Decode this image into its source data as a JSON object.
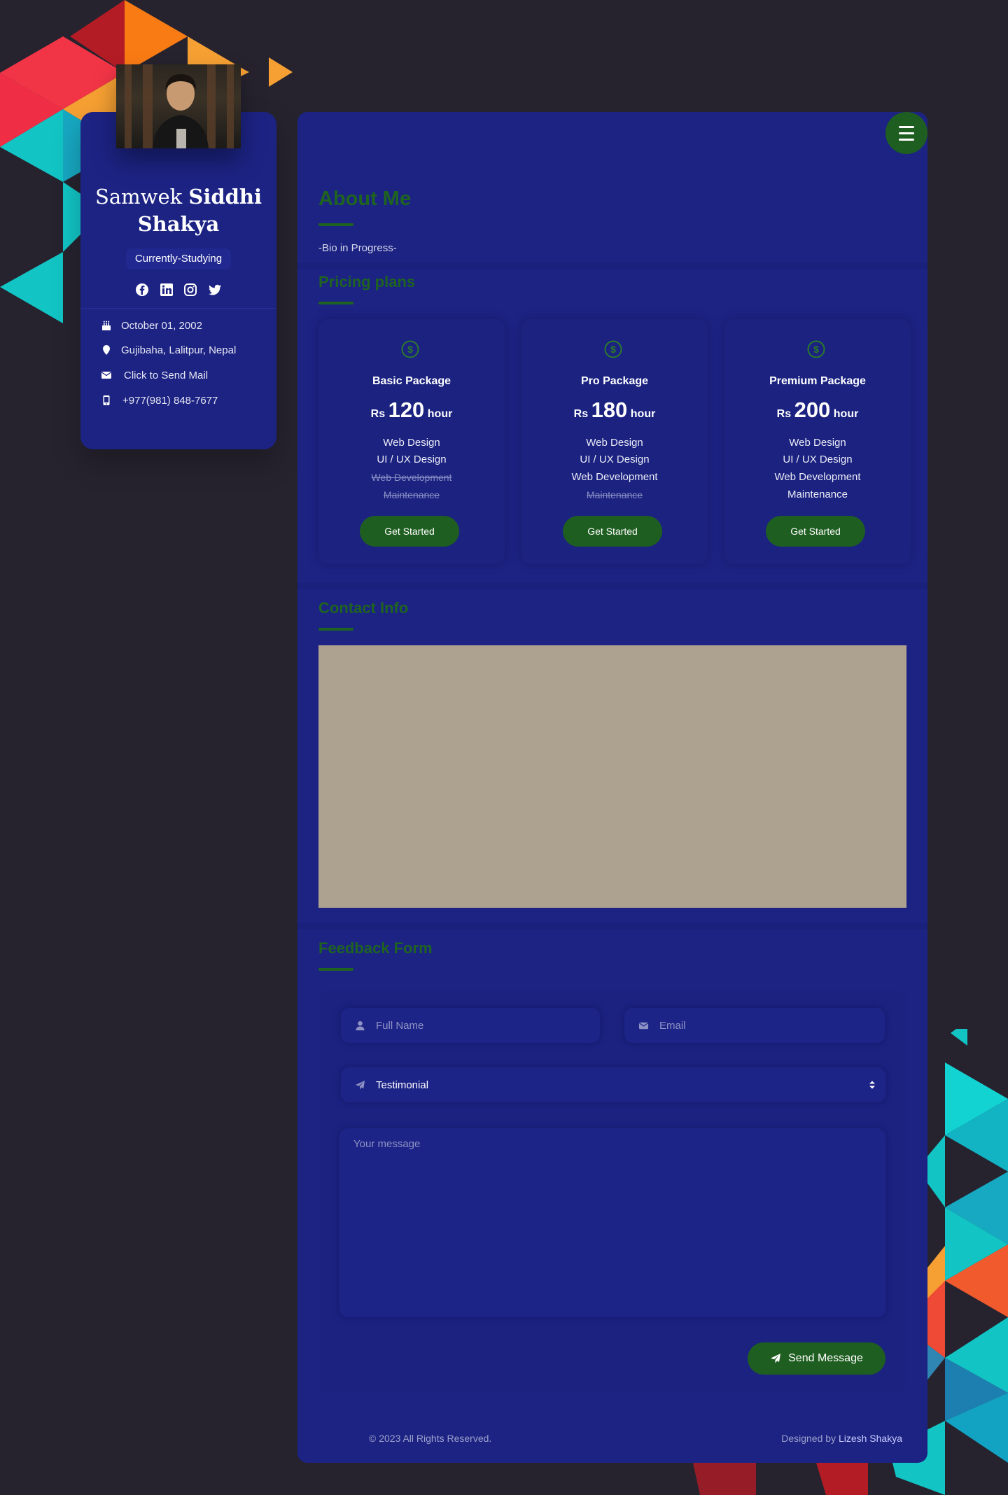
{
  "colors": {
    "page_background": "#26232f",
    "panel": "#1c2383",
    "accent_green": "#1f6320",
    "button_green": "#1f5e21",
    "map_placeholder": "#ada190"
  },
  "profile": {
    "first_name": "Samwek",
    "last_name": "Siddhi Shakya",
    "status": "Currently-Studying",
    "socials": [
      "facebook-icon",
      "linkedin-icon",
      "instagram-icon",
      "twitter-icon"
    ],
    "birthday": "October 01, 2002",
    "location": "Gujibaha, Lalitpur, Nepal",
    "mail": "Click to Send Mail",
    "phone": "+977(981) 848-7677"
  },
  "about": {
    "title": "About Me",
    "bio": "-Bio in Progress-"
  },
  "pricing": {
    "title": "Pricing plans",
    "currency": "Rs",
    "unit": "hour",
    "plans": [
      {
        "name": "Basic Package",
        "price": "120",
        "features": [
          {
            "label": "Web Design",
            "included": true
          },
          {
            "label": "UI / UX Design",
            "included": true
          },
          {
            "label": "Web Development",
            "included": false
          },
          {
            "label": "Maintenance",
            "included": false
          }
        ],
        "button": "Get Started"
      },
      {
        "name": "Pro Package",
        "price": "180",
        "features": [
          {
            "label": "Web Design",
            "included": true
          },
          {
            "label": "UI / UX Design",
            "included": true
          },
          {
            "label": "Web Development",
            "included": true
          },
          {
            "label": "Maintenance",
            "included": false
          }
        ],
        "button": "Get Started"
      },
      {
        "name": "Premium Package",
        "price": "200",
        "features": [
          {
            "label": "Web Design",
            "included": true
          },
          {
            "label": "UI / UX Design",
            "included": true
          },
          {
            "label": "Web Development",
            "included": true
          },
          {
            "label": "Maintenance",
            "included": true
          }
        ],
        "button": "Get Started"
      }
    ]
  },
  "contact": {
    "title": "Contact Info"
  },
  "feedback": {
    "title": "Feedback Form",
    "name_placeholder": "Full Name",
    "email_placeholder": "Email",
    "type_value": "Testimonial",
    "message_placeholder": "Your message",
    "send_label": "Send Message"
  },
  "footer": {
    "copyright": "© 2023 All Rights Reserved.",
    "designed_by": "Designed by",
    "designer": "Lizesh Shakya"
  }
}
